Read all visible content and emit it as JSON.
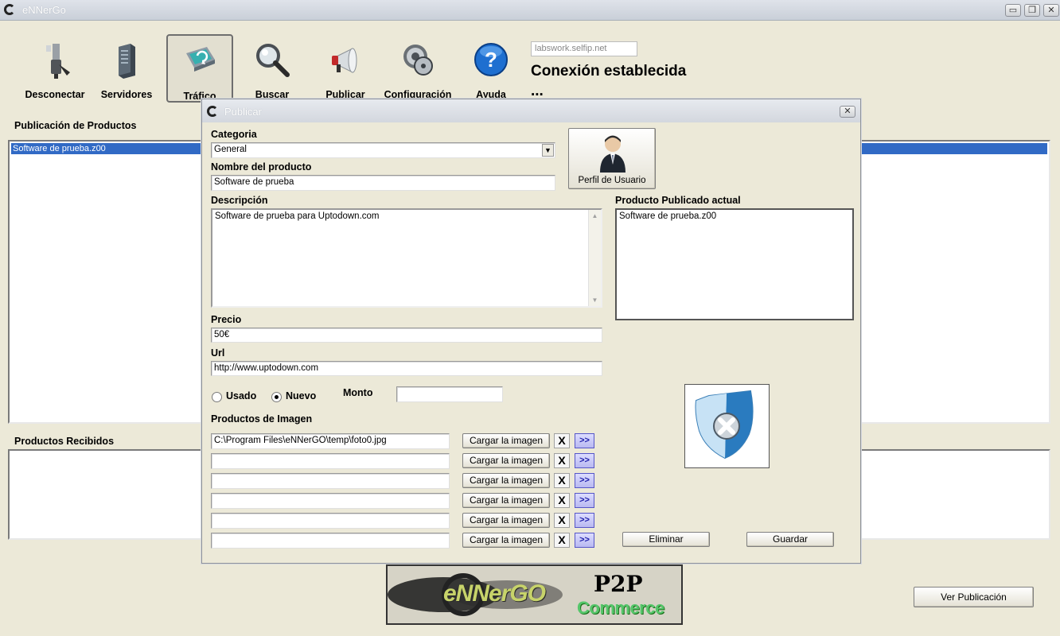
{
  "window": {
    "title": "eNNerGo",
    "controls": [
      "minimize-icon",
      "restore-icon",
      "close-icon"
    ]
  },
  "toolbar": {
    "items": [
      {
        "label": "Desconectar",
        "icon": "disconnect-plug-icon"
      },
      {
        "label": "Servidores",
        "icon": "server-tower-icon"
      },
      {
        "label": "Tráfico",
        "icon": "traffic-monitor-icon"
      },
      {
        "label": "Buscar",
        "icon": "magnifier-icon"
      },
      {
        "label": "Publicar",
        "icon": "megaphone-icon"
      },
      {
        "label": "Configuración",
        "icon": "gear-cd-icon"
      },
      {
        "label": "Ayuda",
        "icon": "help-icon"
      }
    ]
  },
  "connection": {
    "server": "labswork.selfip.net",
    "status": "Conexión establecida ..."
  },
  "main": {
    "published_title": "Publicación de Productos",
    "published_items": [
      "Software de prueba.z00"
    ],
    "received_title": "Productos Recibidos",
    "view_button": "Ver Publicación",
    "banner_text": "eNNerGO",
    "banner_p2p": "P2P",
    "banner_commerce": "Commerce"
  },
  "dialog": {
    "title": "Publicar",
    "category_label": "Categoria",
    "category_value": "General",
    "name_label": "Nombre del producto",
    "name_value": "Software de prueba",
    "profile_button": "Perfil de Usuario",
    "description_label": "Descripción",
    "description_value": "Software de prueba para Uptodown.com",
    "current_label": "Producto Publicado actual",
    "current_value": "Software de prueba.z00",
    "price_label": "Precio",
    "price_value": "50€",
    "url_label": "Url",
    "url_value": "http://www.uptodown.com",
    "condition_used": "Usado",
    "condition_new": "Nuevo",
    "condition_selected": "Nuevo",
    "amount_label": "Monto",
    "amount_value": "",
    "images_label": "Productos de Imagen",
    "load_button": "Cargar la imagen",
    "remove_symbol": "X",
    "next_symbol": ">>",
    "images": [
      "C:\\Program Files\\eNNerGO\\temp\\foto0.jpg",
      "",
      "",
      "",
      "",
      ""
    ],
    "delete_button": "Eliminar",
    "save_button": "Guardar",
    "shield_icon": "security-shield-x-icon",
    "colors": {
      "selection": "#316ac5",
      "window": "#ece9d8"
    }
  }
}
